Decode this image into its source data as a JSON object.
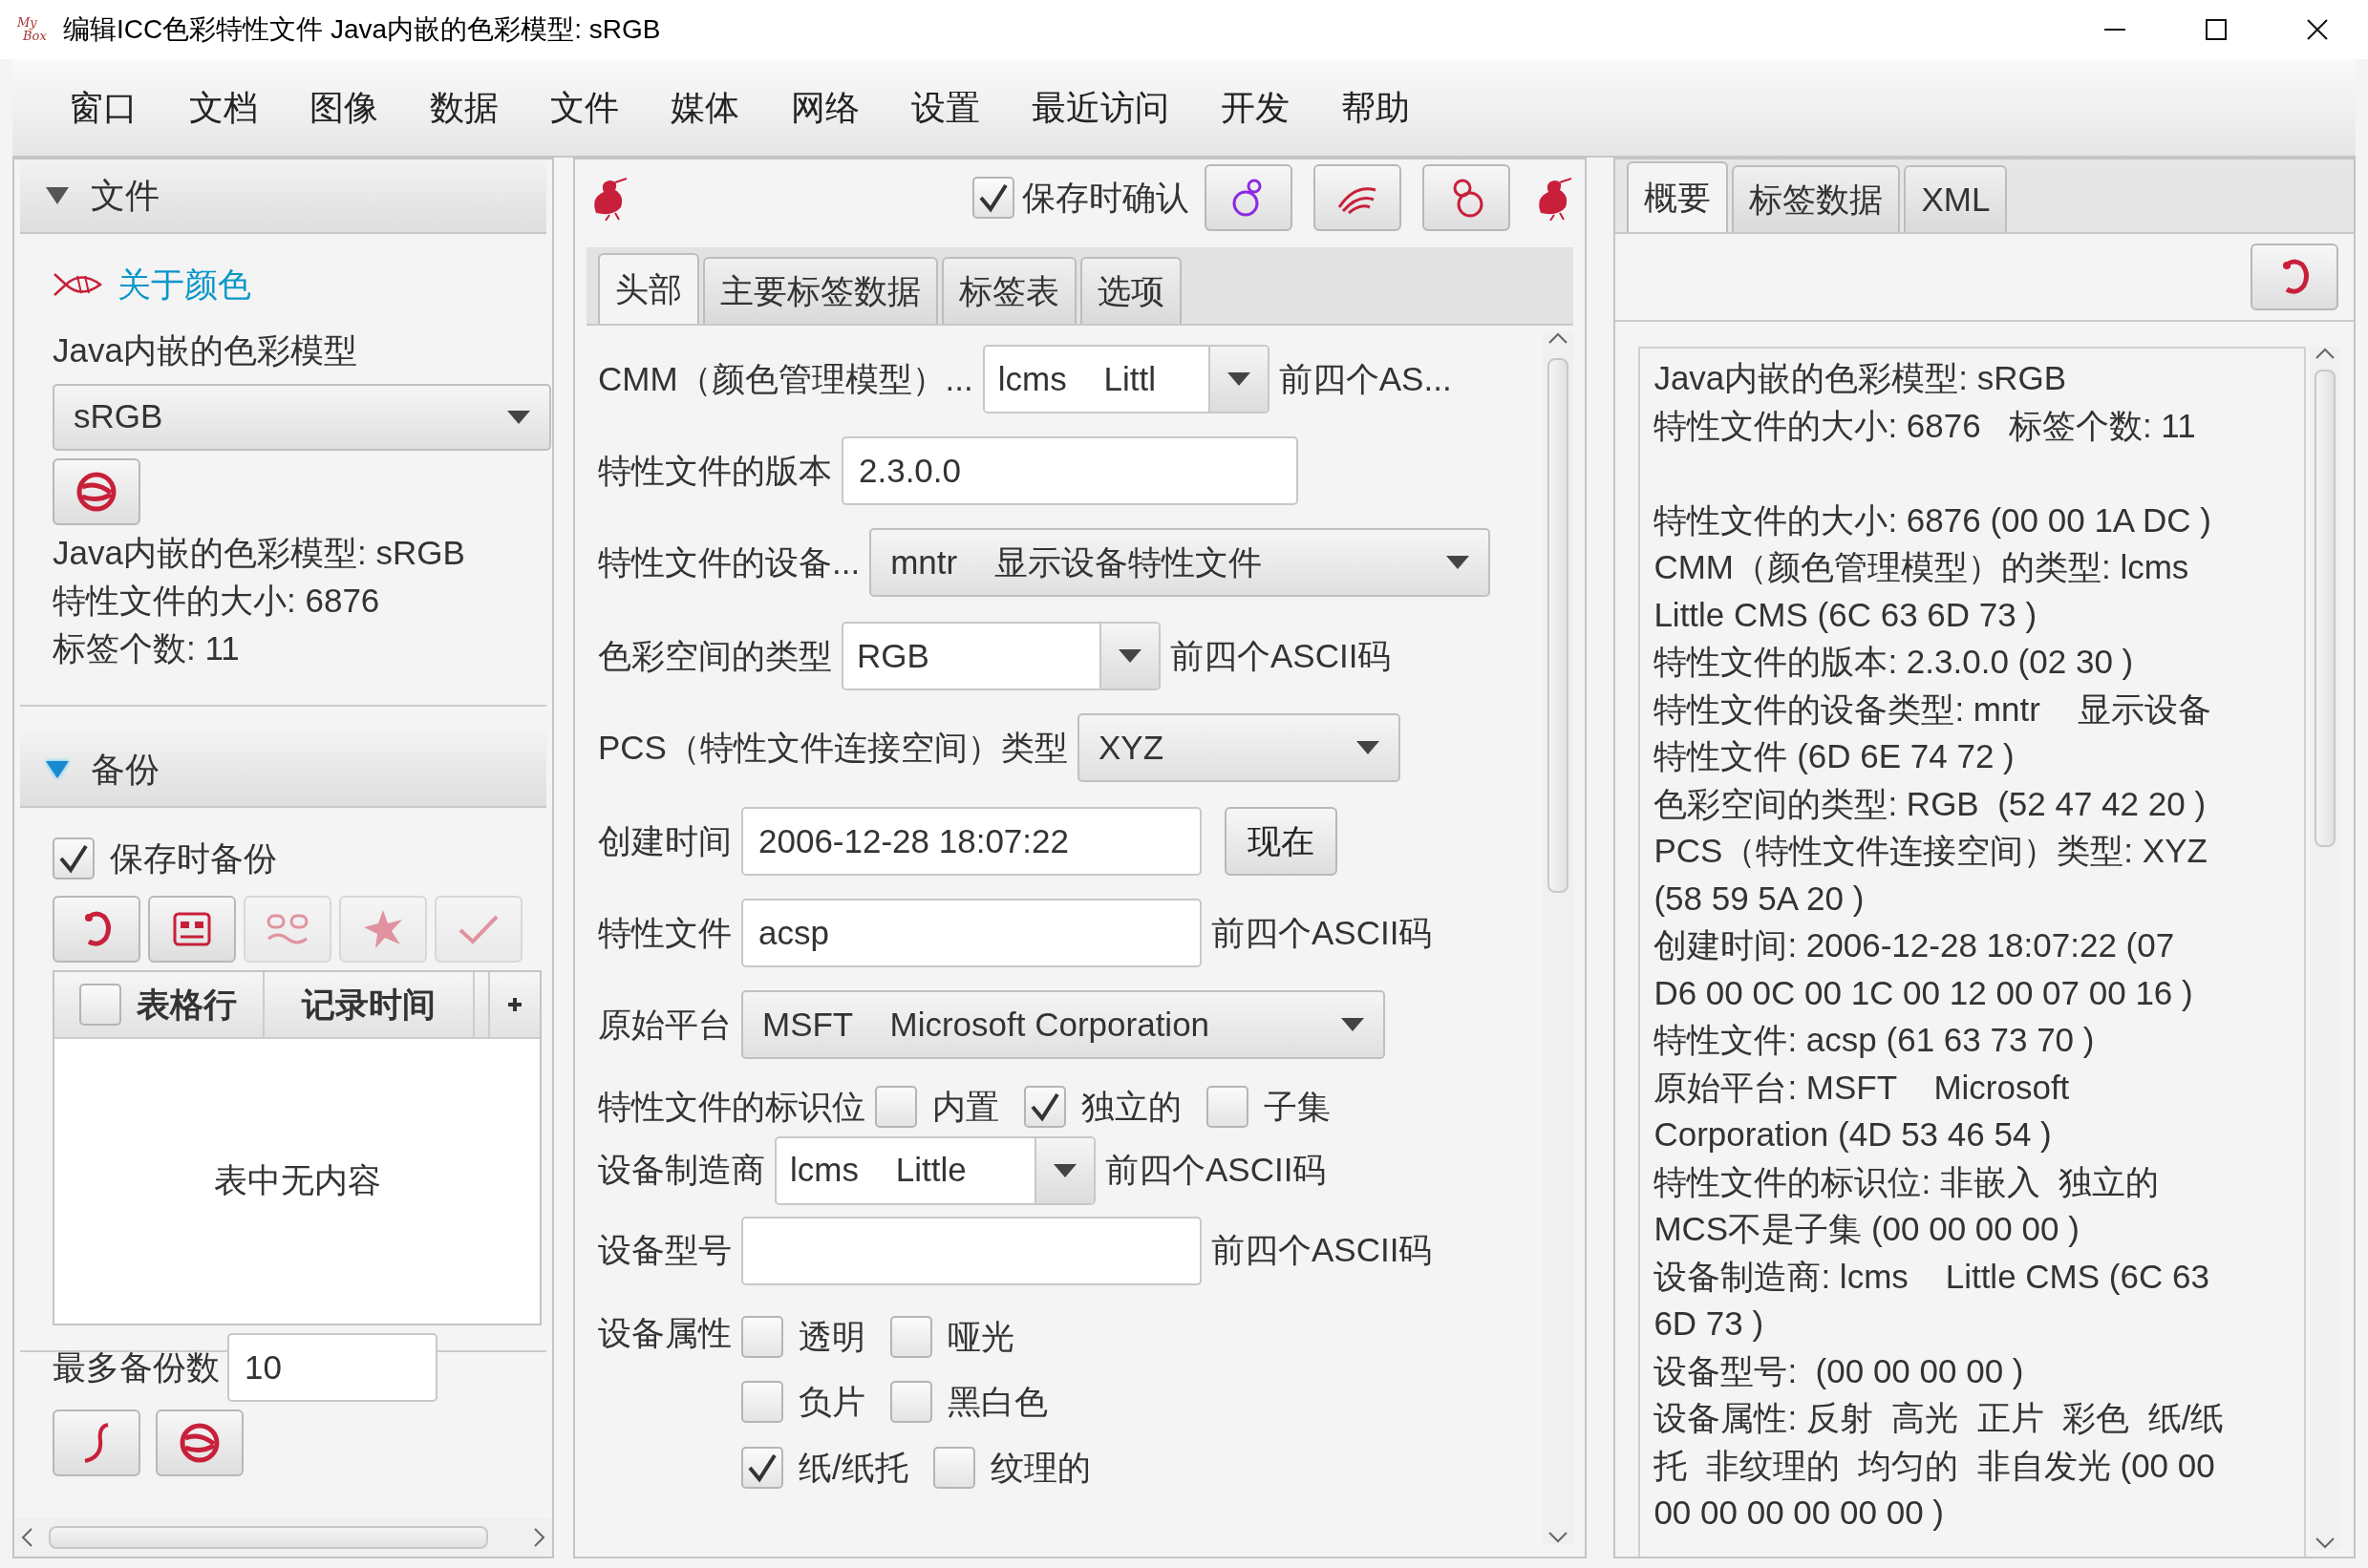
{
  "window": {
    "title": "编辑ICC色彩特性文件  Java内嵌的色彩模型: sRGB",
    "logo": [
      "My",
      "Box"
    ]
  },
  "menu": [
    "窗口",
    "文档",
    "图像",
    "数据",
    "文件",
    "媒体",
    "网络",
    "设置",
    "最近访问",
    "开发",
    "帮助"
  ],
  "left": {
    "file_section": {
      "title": "文件",
      "expanded": true,
      "focused": false,
      "link": "关于颜色",
      "label": "Java内嵌的色彩模型",
      "select": "sRGB",
      "info": [
        "Java内嵌的色彩模型: sRGB",
        "特性文件的大小: 6876",
        "标签个数: 11"
      ]
    },
    "backup_section": {
      "title": "备份",
      "expanded": true,
      "focused": true,
      "checkbox": {
        "label": "保存时备份",
        "checked": true
      },
      "buttons": [
        {
          "kind": "refresh",
          "disabled": false
        },
        {
          "kind": "view",
          "disabled": false
        },
        {
          "kind": "use",
          "disabled": true
        },
        {
          "kind": "delete",
          "disabled": true
        },
        {
          "kind": "ok",
          "disabled": true
        }
      ],
      "table": {
        "all_checked": false,
        "columns": [
          "表格行",
          "记录时间"
        ],
        "empty": "表中无内容"
      },
      "max_label": "最多备份数",
      "max_value": "10",
      "bottom_buttons": [
        {
          "kind": "clear",
          "disabled": false
        },
        {
          "kind": "save",
          "disabled": false
        }
      ]
    }
  },
  "middle": {
    "toolbar": {
      "confirm": {
        "label": "保存时确认",
        "checked": true
      },
      "buttons": [
        {
          "kind": "open"
        },
        {
          "kind": "swap"
        },
        {
          "kind": "save"
        }
      ]
    },
    "tabs": [
      {
        "label": "头部",
        "selected": true
      },
      {
        "label": "主要标签数据",
        "selected": false
      },
      {
        "label": "标签表",
        "selected": false
      },
      {
        "label": "选项",
        "selected": false
      }
    ],
    "rows": [
      {
        "kind": "combo",
        "label": "CMM（颜色管理模型）...",
        "value": "lcms    Littl",
        "suffix": "前四个AS..."
      },
      {
        "kind": "text",
        "label": "特性文件的版本",
        "value": "2.3.0.0"
      },
      {
        "kind": "choice",
        "label": "特性文件的设备...",
        "value": "mntr    显示设备特性文件"
      },
      {
        "kind": "combo",
        "label": "色彩空间的类型",
        "value": "RGB",
        "suffix": "前四个ASCII码"
      },
      {
        "kind": "choice",
        "label": "PCS（特性文件连接空间）类型",
        "value": "XYZ"
      },
      {
        "kind": "text",
        "label": "创建时间",
        "value": "2006-12-28 18:07:22",
        "button": "现在"
      },
      {
        "kind": "text",
        "label": "特性文件",
        "value": "acsp",
        "suffix": "前四个ASCII码"
      },
      {
        "kind": "choice",
        "label": "原始平台",
        "value": "MSFT    Microsoft Corporation"
      },
      {
        "kind": "checks",
        "label": "特性文件的标识位",
        "option_rows": [
          [
            {
              "label": "内置",
              "checked": false
            },
            {
              "label": "独立的",
              "checked": true
            },
            {
              "label": "子集",
              "checked": false
            }
          ]
        ]
      },
      {
        "kind": "combo",
        "label": "设备制造商",
        "value": "lcms    Little",
        "suffix": "前四个ASCII码"
      },
      {
        "kind": "text",
        "label": "设备型号",
        "suffix": "前四个ASCII码"
      },
      {
        "kind": "checks",
        "label": "设备属性",
        "option_rows": [
          [
            {
              "label": "透明",
              "checked": false
            },
            {
              "label": "哑光",
              "checked": false
            }
          ],
          [
            {
              "label": "负片",
              "checked": false
            },
            {
              "label": "黑白色",
              "checked": false
            }
          ],
          [
            {
              "label": "纸/纸托",
              "checked": true
            },
            {
              "label": "纹理的",
              "checked": false
            }
          ]
        ]
      }
    ]
  },
  "right": {
    "tabs": [
      {
        "label": "概要",
        "selected": true
      },
      {
        "label": "标签数据",
        "selected": false
      },
      {
        "label": "XML",
        "selected": false
      }
    ],
    "summary_lines": [
      "Java内嵌的色彩模型: sRGB",
      "特性文件的大小: 6876   标签个数: 11"
    ],
    "detail_lines": [
      "特性文件的大小: 6876 (00 00 1A DC )",
      "CMM（颜色管理模型）的类型: lcms",
      "Little CMS (6C 63 6D 73 )",
      "特性文件的版本: 2.3.0.0 (02 30 )",
      "特性文件的设备类型: mntr    显示设备",
      "特性文件 (6D 6E 74 72 )",
      "色彩空间的类型: RGB  (52 47 42 20 )",
      "PCS（特性文件连接空间）类型: XYZ",
      "(58 59 5A 20 )",
      "创建时间: 2006-12-28 18:07:22 (07",
      "D6 00 0C 00 1C 00 12 00 07 00 16 )",
      "特性文件: acsp (61 63 73 70 )",
      "原始平台: MSFT    Microsoft",
      "Corporation (4D 53 46 54 )",
      "特性文件的标识位: 非嵌入  独立的",
      "MCS不是子集 (00 00 00 00 )",
      "设备制造商: lcms    Little CMS (6C 63",
      "6D 73 )",
      "设备型号:  (00 00 00 00 )",
      "设备属性: 反射  高光  正片  彩色  纸/纸",
      "托  非纹理的  均匀的  非自发光 (00 00",
      "00 00 00 00 00 00 )"
    ]
  }
}
